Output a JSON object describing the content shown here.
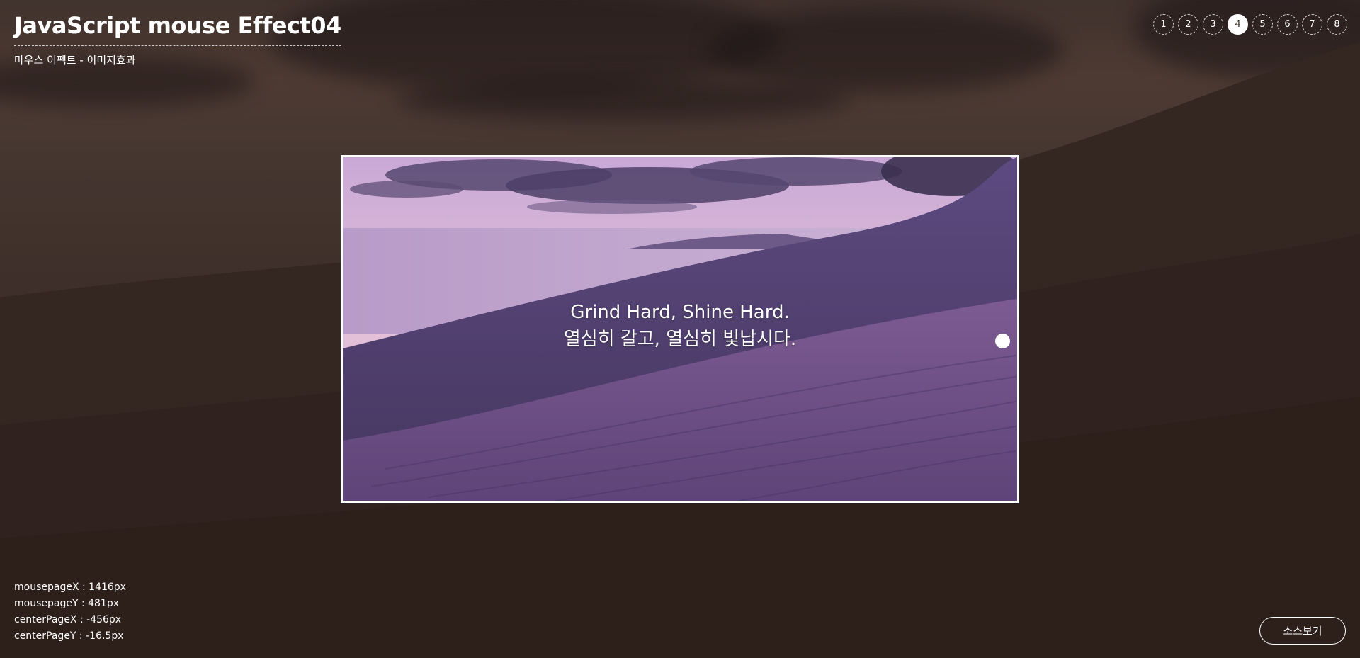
{
  "header": {
    "title": "JavaScript mouse Effect04",
    "subtitle": "마우스 이펙트 - 이미지효과"
  },
  "pagination": {
    "pages": [
      "1",
      "2",
      "3",
      "4",
      "5",
      "6",
      "7",
      "8"
    ],
    "active": "4"
  },
  "panel": {
    "line1": "Grind Hard, Shine Hard.",
    "line2": "열심히 갈고, 열심히 빛납시다."
  },
  "info": {
    "mousepageX": "mousepageX : 1416px",
    "mousepageY": "mousepageY : 481px",
    "centerPageX": "centerPageX : -456px",
    "centerPageY": "centerPageY : -16.5px"
  },
  "source_button": "소스보기",
  "colors": {
    "accent": "#ffffff",
    "background": "#3f302b",
    "panel_sky": "#b892c4",
    "panel_dune": "#5a4478"
  }
}
